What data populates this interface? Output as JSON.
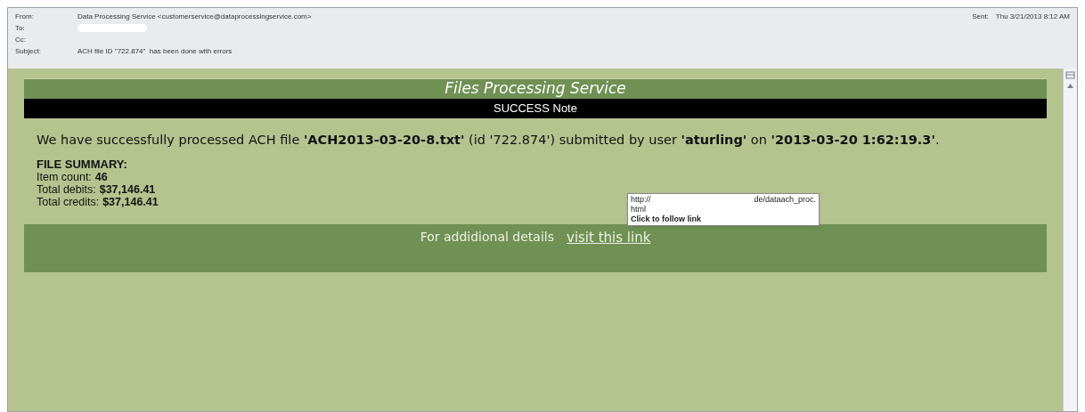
{
  "header": {
    "fields": [
      {
        "label": "From:",
        "value": "Data Processing Service <customerservice@dataprocessingservice.com>",
        "kind": "text"
      },
      {
        "label": "To:",
        "kind": "redacted"
      },
      {
        "label": "Cc:",
        "kind": "text"
      },
      {
        "label": "Subject:",
        "value": "ACH file ID \"722.874\"  has been done with errors",
        "kind": "text"
      }
    ],
    "sent_label": "Sent:",
    "sent_value": "Thu 3/21/2013 8:12 AM"
  },
  "message": {
    "title": "Files Processing Service",
    "note": "SUCCESS Note",
    "paragraph": "We have successfully processed ACH file **'ACH2013-03-20-8.txt'** (id '722.874') submitted by user **'aturling'** on **'2013-03-20 1:62:19.3'**.",
    "summary_title": "FILE SUMMARY:",
    "summary": [
      {
        "label": "Item count:",
        "value": "46"
      },
      {
        "label": "Total debits:",
        "value": "$37,146.41"
      },
      {
        "label": "Total credits:",
        "value": "$37,146.41"
      }
    ],
    "footer_text": "For addidional details",
    "link": "visit this link"
  },
  "tooltip": {
    "url_start": "http://",
    "url_end": "de/dataach_proc.",
    "url_line2": "html",
    "hint": "Click to follow link"
  }
}
